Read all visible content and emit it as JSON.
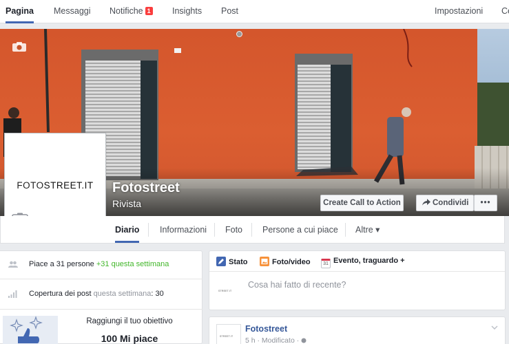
{
  "top_nav": {
    "items": [
      "Pagina",
      "Messaggi",
      "Notifiche",
      "Insights",
      "Post"
    ],
    "notifications_badge": "1",
    "right_items": [
      "Impostazioni",
      "Ce"
    ]
  },
  "page": {
    "name": "Fotostreet",
    "category": "Rivista",
    "logo_text_light": "FOTO",
    "logo_text_bold": "STREET.IT"
  },
  "cover_actions": {
    "cta_label": "Create Call to Action",
    "share_label": "Condividi",
    "more_label": "•••"
  },
  "tabs": [
    "Diario",
    "Informazioni",
    "Foto",
    "Persone a cui piace",
    "Altre ▾"
  ],
  "left_stats": {
    "likes_prefix": "Piace a 31 persone ",
    "likes_delta": "+31 questa settimana",
    "reach_prefix": "Copertura dei post ",
    "reach_period": "questa settimana",
    "reach_value": ": 30"
  },
  "goal": {
    "title": "Raggiungi il tuo obiettivo",
    "value": "100 Mi piace"
  },
  "composer": {
    "tabs": [
      "Stato",
      "Foto/video",
      "Evento, traguardo +"
    ],
    "placeholder": "Cosa hai fatto di recente?",
    "calendar_day": "31"
  },
  "post": {
    "author": "Fotostreet",
    "meta": "5 h · Modificato · "
  },
  "colors": {
    "accent": "#4267b2",
    "badge": "#fa3e3e",
    "link": "#365899",
    "green": "#42b72a",
    "cover_wall": "#d9542b"
  }
}
